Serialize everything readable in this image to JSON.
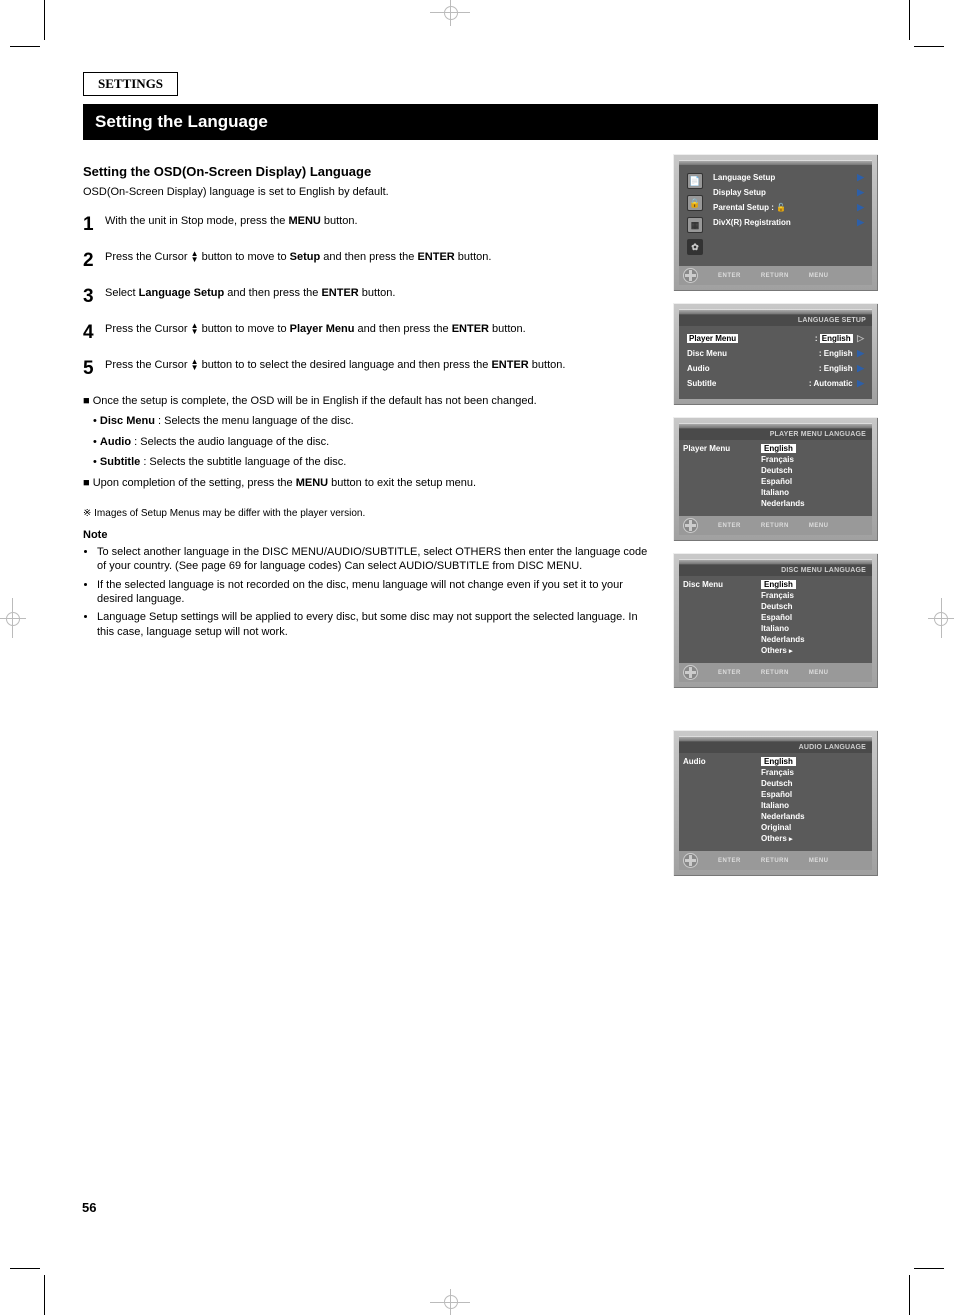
{
  "doc": {
    "settings_label": "SETTINGS",
    "title": "Setting the Language",
    "intro_heading": "Setting the OSD(On-Screen Display) Language",
    "intro_text": "OSD(On-Screen Display) language is set to English by default.",
    "steps": [
      {
        "n": "1",
        "text": "With the unit in Stop mode, press the <b>MENU</b> button."
      },
      {
        "n": "2",
        "text": "Press the Cursor <img/> button to move to <b>Setup</b> and then press the <b>ENTER</b> button."
      },
      {
        "n": "3",
        "text": "Select <b>Language Setup</b> and then press the <b>ENTER</b> button."
      },
      {
        "n": "4",
        "text": "Press the Cursor <img/> button to move to <b>Player Menu</b> and then press the <b>ENTER</b> button."
      },
      {
        "n": "5",
        "text": "Press the Cursor <img/> button to to select the desired language and then press the <b>ENTER</b> button."
      }
    ],
    "post_steps": [
      "Once the setup is complete, the OSD will be in English if the default has not been changed.",
      "<b>Disc Menu</b> : Selects the menu language of the disc.",
      "<b>Audio</b> : Selects the audio language of the disc.",
      "<b>Subtitle</b> : Selects the subtitle language of the disc.",
      "Upon completion of the setting, press the <b>MENU</b> button to exit the setup menu."
    ],
    "note_label": "Note",
    "notes": [
      "To select another language in the DISC MENU/AUDIO/SUBTITLE, select OTHERS then enter the language code of your country. (See page 69 for language codes) Can select AUDIO/SUBTITLE from DISC MENU.",
      "If the selected language is not recorded on the disc, menu language will not change even if you set it to your desired language.",
      "Language Setup settings will be applied to every disc, but some disc may not support the selected language. In this case, language setup will not work."
    ],
    "sub_note": "※ Images of Setup Menus may be differ with the player version."
  },
  "osd": {
    "main": {
      "items": [
        {
          "label": "Language Setup",
          "icon": "lock",
          "extra": ""
        },
        {
          "label": "Display Setup",
          "icon": "",
          "extra": ""
        },
        {
          "label": "Parental Setup :",
          "icon": "",
          "extra": "lock"
        },
        {
          "label": "DivX(R) Registration",
          "icon": "",
          "extra": ""
        }
      ],
      "left_icons": [
        "📄",
        "🔒",
        "▦",
        "✿"
      ]
    },
    "lang_setup": {
      "title": "LANGUAGE SETUP",
      "rows": [
        {
          "label": "Player Menu",
          "val": "English",
          "sel": true
        },
        {
          "label": "Disc Menu",
          "val": "English"
        },
        {
          "label": "Audio",
          "val": "English"
        },
        {
          "label": "Subtitle",
          "val": "Automatic"
        }
      ]
    },
    "player_menu": {
      "title": "PLAYER MENU LANGUAGE",
      "left": "Player Menu",
      "options": [
        "English",
        "Français",
        "Deutsch",
        "Español",
        "Italiano",
        "Nederlands"
      ]
    },
    "disc_menu": {
      "title": "DISC MENU LANGUAGE",
      "left": "Disc Menu",
      "options": [
        "English",
        "Français",
        "Deutsch",
        "Español",
        "Italiano",
        "Nederlands",
        "Others"
      ]
    },
    "audio_menu": {
      "title": "AUDIO LANGUAGE",
      "left": "Audio",
      "options": [
        "English",
        "Français",
        "Deutsch",
        "Español",
        "Italiano",
        "Nederlands",
        "Original",
        "Others"
      ]
    },
    "footer": {
      "enter": "ENTER",
      "return": "RETURN",
      "menu": "MENU"
    }
  },
  "page_num": "56"
}
